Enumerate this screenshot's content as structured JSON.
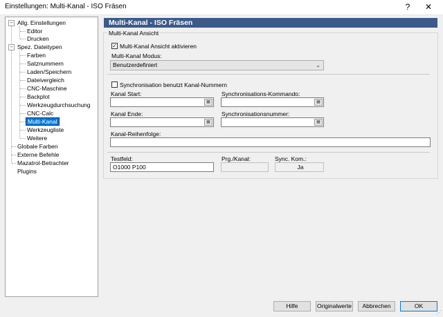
{
  "window": {
    "title": "Einstellungen: Multi-Kanal - ISO Fräsen",
    "help_glyph": "?",
    "close_glyph": "✕"
  },
  "tree": {
    "expand_minus": "−",
    "items": [
      {
        "label": "Allg. Einstellungen"
      },
      {
        "label": "Editor"
      },
      {
        "label": "Drucken"
      },
      {
        "label": "Spez. Dateitypen"
      },
      {
        "label": "Farben"
      },
      {
        "label": "Satznummern"
      },
      {
        "label": "Laden/Speichern"
      },
      {
        "label": "Dateivergleich"
      },
      {
        "label": "CNC-Maschine"
      },
      {
        "label": "Backplot"
      },
      {
        "label": "Werkzeugdurchsuchung"
      },
      {
        "label": "CNC-Calc"
      },
      {
        "label": "Multi-Kanal"
      },
      {
        "label": "Werkzeugliste"
      },
      {
        "label": "Weitere"
      },
      {
        "label": "Globale Farben"
      },
      {
        "label": "Externe Befehle"
      },
      {
        "label": "Mazatrol-Betrachter"
      },
      {
        "label": "Plugins"
      }
    ],
    "selected": "Multi-Kanal"
  },
  "panel": {
    "header": "Multi-Kanal - ISO Fräsen",
    "group_title": "Multi-Kanal Ansicht",
    "activate_label": "Multi-Kanal Ansicht aktivieren",
    "activate_checked": true,
    "check_glyph": "✓",
    "mode_label": "Multi-Kanal Modus:",
    "mode_value": "Benutzerdefiniert",
    "dropdown_glyph": "⌄",
    "sync_label": "Synchronisation benutzt Kanal-Nummern",
    "sync_checked": false,
    "kanal_start_label": "Kanal Start:",
    "kanal_start_value": "",
    "sync_cmd_label": "Synchronisations-Kommando:",
    "sync_cmd_value": "",
    "kanal_ende_label": "Kanal Ende:",
    "kanal_ende_value": "",
    "sync_num_label": "Synchronisationsnummer:",
    "sync_num_value": "",
    "picker_glyph": "▦",
    "reihenfolge_label": "Kanal-Reihenfolge:",
    "reihenfolge_value": "",
    "testfeld_label": "Testfeld:",
    "testfeld_value": "O1000 P100",
    "prg_kanal_label": "Prg./Kanal:",
    "prg_kanal_value": "",
    "sync_kom_label": "Sync. Kom.:",
    "sync_kom_value": "Ja"
  },
  "buttons": {
    "help": "Hilfe",
    "defaults": "Originalwerte",
    "cancel": "Abbrechen",
    "ok": "OK"
  }
}
